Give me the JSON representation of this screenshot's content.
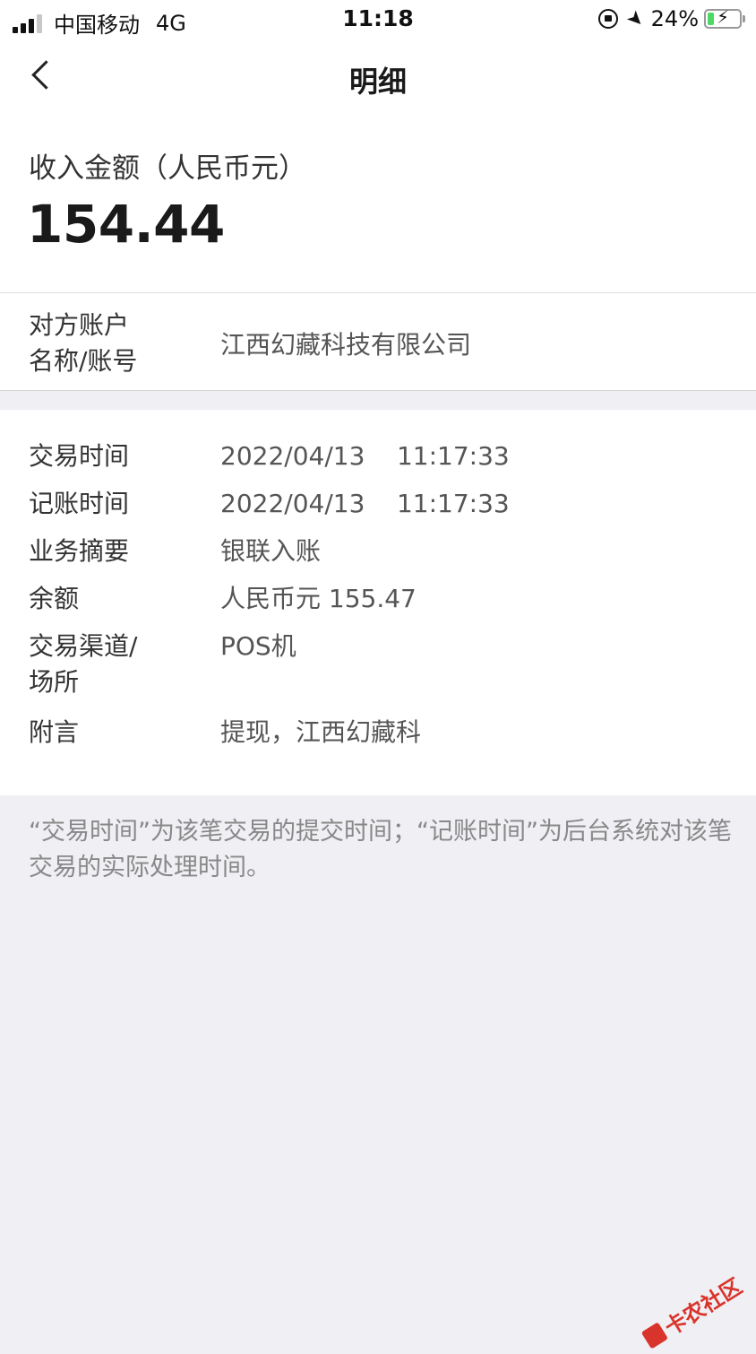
{
  "status": {
    "carrier": "中国移动",
    "network": "4G",
    "time": "11:18",
    "battery_percent": "24%",
    "battery_level": 0.24,
    "battery_color": "#4cd964"
  },
  "nav": {
    "title": "明细"
  },
  "amount": {
    "label": "收入金额（人民币元）",
    "value": "154.44"
  },
  "counterparty": {
    "label": "对方账户名称/账号",
    "label_line1": "对方账户",
    "label_line2": "名称/账号",
    "value": "江西幻藏科技有限公司"
  },
  "details": [
    {
      "label": "交易时间",
      "value": "2022/04/13    11:17:33"
    },
    {
      "label": "记账时间",
      "value": "2022/04/13    11:17:33"
    },
    {
      "label": "业务摘要",
      "value": "银联入账"
    },
    {
      "label": "余额",
      "value": "人民币元 155.47"
    },
    {
      "label": "交易渠道/场所",
      "label_line1": "交易渠道/",
      "label_line2": "场所",
      "value": "POS机"
    },
    {
      "label": "附言",
      "value": "提现，江西幻藏科"
    }
  ],
  "note": "“交易时间”为该笔交易的提交时间；“记账时间”为后台系统对该笔交易的实际处理时间。",
  "watermark": {
    "text": "卡农社区",
    "color": "#d9342b"
  }
}
